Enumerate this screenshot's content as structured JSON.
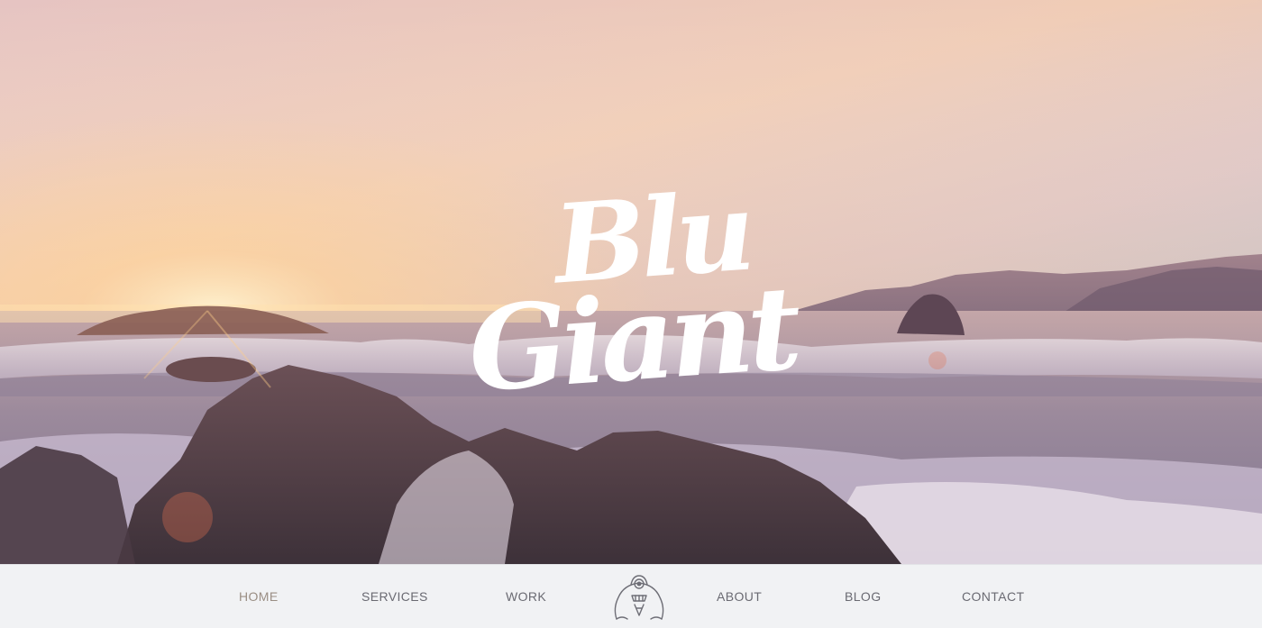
{
  "brand": {
    "logo_line1": "Blu",
    "logo_line2": "Giant",
    "logo_color": "#ffffff"
  },
  "nav": {
    "items": [
      {
        "label": "HOME",
        "active": true
      },
      {
        "label": "SERVICES",
        "active": false
      },
      {
        "label": "WORK",
        "active": false
      },
      {
        "label": "ABOUT",
        "active": false
      },
      {
        "label": "BLOG",
        "active": false
      },
      {
        "label": "CONTACT",
        "active": false
      }
    ],
    "mascot_icon": "one-eyed-giant-mascot-icon",
    "text_color": "#6a6a72",
    "active_color": "#9a8e84",
    "background": "#f1f2f4"
  },
  "hero": {
    "scene": "sunset-ocean-rocks",
    "sky_colors": [
      "#e9c9c1",
      "#f2c8a9",
      "#d2c7cf"
    ],
    "sea_color": "#8e7f91",
    "rock_color": "#4a3a40"
  }
}
